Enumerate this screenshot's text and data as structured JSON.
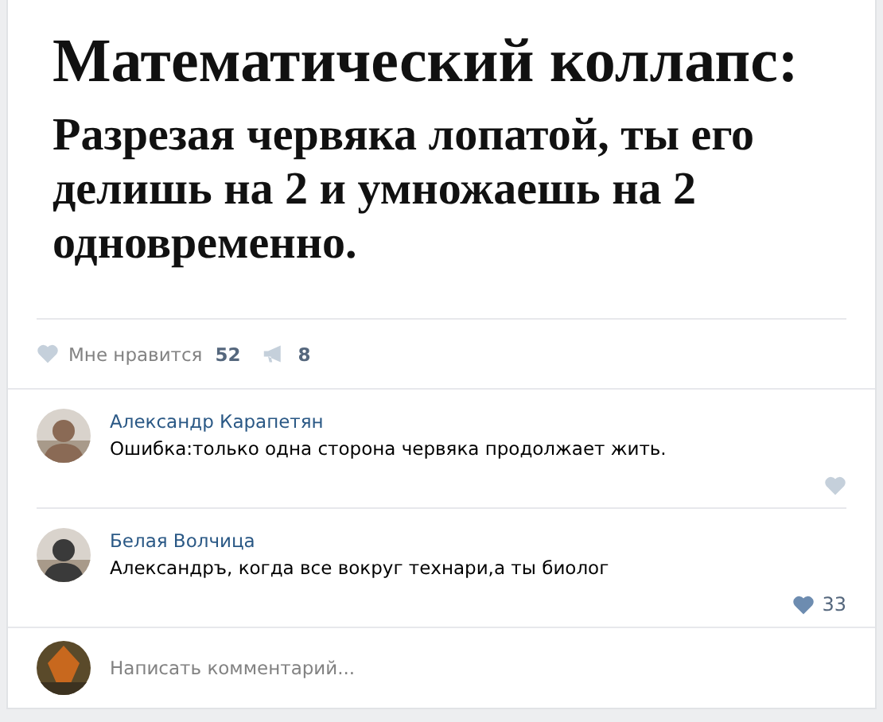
{
  "post": {
    "title": "Математический коллапс:",
    "body": "Разрезая червяка лопатой, ты его делишь на 2 и умножаешь на 2 одновременно."
  },
  "actions": {
    "like_label": "Мне нравится",
    "like_count": "52",
    "share_count": "8"
  },
  "comments": [
    {
      "author": "Александр Карапетян",
      "text": "Ошибка:только одна сторона червяка продолжает жить."
    },
    {
      "author": "Белая Волчица",
      "text": "Александръ, когда все вокруг технари,а ты биолог",
      "likes": "33"
    }
  ],
  "reply": {
    "placeholder": "Написать комментарий..."
  }
}
